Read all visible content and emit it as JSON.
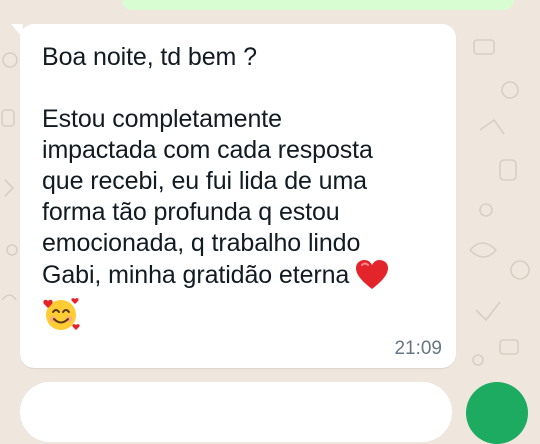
{
  "message": {
    "lines": [
      "Boa noite, td bem ?",
      "",
      "Estou completamente",
      "impactada com cada resposta",
      "que recebi, eu fui lida de uma",
      "forma tão profunda q estou",
      "emocionada, q trabalho lindo",
      "Gabi, minha gratidão eterna"
    ],
    "emojis": [
      "red-heart-icon",
      "smiling-face-with-hearts-icon"
    ],
    "time": "21:09"
  },
  "colors": {
    "wallpaper": "#efe7de",
    "bubble_received": "#ffffff",
    "bubble_sent": "#d9fdd3",
    "accent": "#1daa61",
    "timestamp": "#667781"
  }
}
